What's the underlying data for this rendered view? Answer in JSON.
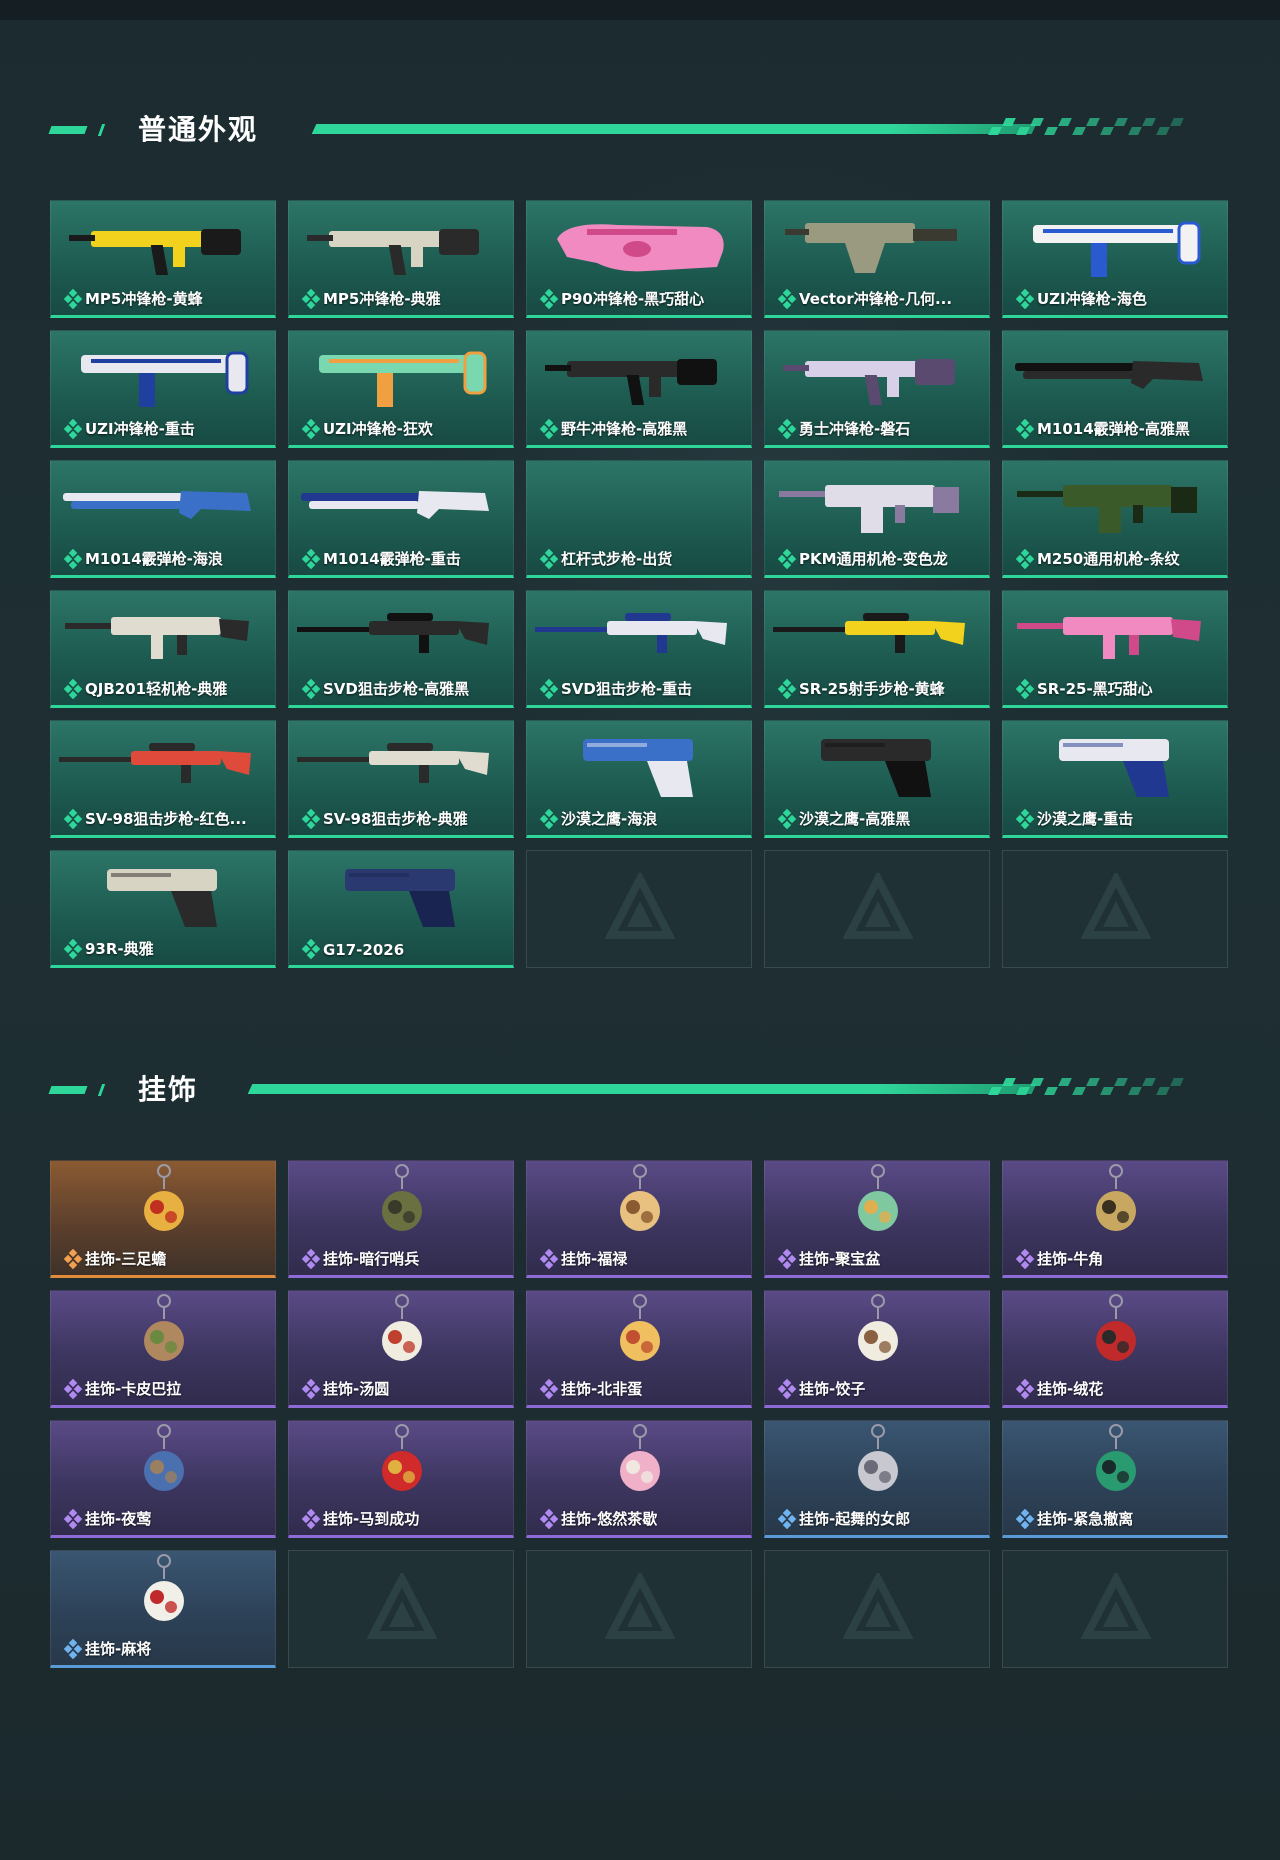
{
  "sections": {
    "skins": {
      "title": "普通外观"
    },
    "charms": {
      "title": "挂饰"
    }
  },
  "colors": {
    "accent": "#2fd69a",
    "purple": "#8d6ad6",
    "orange": "#e08a3a",
    "blue": "#5a9ad6"
  },
  "skins": [
    {
      "label": "MP5冲锋枪-黄蜂",
      "art": "smg",
      "c1": "#f2d21c",
      "c2": "#1a1a1a"
    },
    {
      "label": "MP5冲锋枪-典雅",
      "art": "smg",
      "c1": "#d8d4c4",
      "c2": "#2a2a2a"
    },
    {
      "label": "P90冲锋枪-黑巧甜心",
      "art": "p90",
      "c1": "#f08ac0",
      "c2": "#d04a8a"
    },
    {
      "label": "Vector冲锋枪-几何...",
      "art": "vector",
      "c1": "#9a9a80",
      "c2": "#3a3a30"
    },
    {
      "label": "UZI冲锋枪-海色",
      "art": "uzi",
      "c1": "#f2f2f2",
      "c2": "#2a5ad0"
    },
    {
      "label": "UZI冲锋枪-重击",
      "art": "uzi",
      "c1": "#e8e8f0",
      "c2": "#2040a0"
    },
    {
      "label": "UZI冲锋枪-狂欢",
      "art": "uzi",
      "c1": "#7ad8b0",
      "c2": "#f0a040"
    },
    {
      "label": "野牛冲锋枪-高雅黑",
      "art": "smg",
      "c1": "#2a2a2a",
      "c2": "#111111"
    },
    {
      "label": "勇士冲锋枪-磐石",
      "art": "smg",
      "c1": "#d8d0e8",
      "c2": "#5a4a70"
    },
    {
      "label": "M1014霰弹枪-高雅黑",
      "art": "shotgun",
      "c1": "#2a2a2a",
      "c2": "#111111"
    },
    {
      "label": "M1014霰弹枪-海浪",
      "art": "shotgun",
      "c1": "#3a70c8",
      "c2": "#e8e8f0"
    },
    {
      "label": "M1014霰弹枪-重击",
      "art": "shotgun",
      "c1": "#e8e8f0",
      "c2": "#203890"
    },
    {
      "label": "杠杆式步枪-出货",
      "art": "none",
      "c1": "#000000",
      "c2": "#000000"
    },
    {
      "label": "PKM通用机枪-变色龙",
      "art": "mg",
      "c1": "#e0dce8",
      "c2": "#8a7aa0"
    },
    {
      "label": "M250通用机枪-条纹",
      "art": "mg",
      "c1": "#3a5a2a",
      "c2": "#1a2a14"
    },
    {
      "label": "QJB201轻机枪-典雅",
      "art": "rifle",
      "c1": "#e0dcd0",
      "c2": "#2a2a2a"
    },
    {
      "label": "SVD狙击步枪-高雅黑",
      "art": "sniper",
      "c1": "#2a2a2a",
      "c2": "#111111"
    },
    {
      "label": "SVD狙击步枪-重击",
      "art": "sniper",
      "c1": "#e8e8f0",
      "c2": "#203890"
    },
    {
      "label": "SR-25射手步枪-黄蜂",
      "art": "sniper",
      "c1": "#f2d21c",
      "c2": "#1a1a1a"
    },
    {
      "label": "SR-25-黑巧甜心",
      "art": "rifle",
      "c1": "#f08ac0",
      "c2": "#d04a8a"
    },
    {
      "label": "SV-98狙击步枪-红色...",
      "art": "sniper",
      "c1": "#e04a3a",
      "c2": "#2a2a2a"
    },
    {
      "label": "SV-98狙击步枪-典雅",
      "art": "sniper",
      "c1": "#e0dcd0",
      "c2": "#2a2a2a"
    },
    {
      "label": "沙漠之鹰-海浪",
      "art": "pistol",
      "c1": "#3a70c8",
      "c2": "#e8e8f0"
    },
    {
      "label": "沙漠之鹰-高雅黑",
      "art": "pistol",
      "c1": "#2a2a2a",
      "c2": "#111111"
    },
    {
      "label": "沙漠之鹰-重击",
      "art": "pistol",
      "c1": "#e8e8f0",
      "c2": "#203890"
    },
    {
      "label": "93R-典雅",
      "art": "pistol",
      "c1": "#d8d4c4",
      "c2": "#2a2a2a"
    },
    {
      "label": "G17-2026",
      "art": "pistol",
      "c1": "#2a3a70",
      "c2": "#1a2450"
    }
  ],
  "charms": [
    {
      "label": "挂饰-三足蟾",
      "rarity": "orange",
      "c1": "#e8b040",
      "c2": "#c03020"
    },
    {
      "label": "挂饰-暗行哨兵",
      "rarity": "purple",
      "c1": "#6a7040",
      "c2": "#3a3a2a"
    },
    {
      "label": "挂饰-福禄",
      "rarity": "purple",
      "c1": "#e8c080",
      "c2": "#8a5a30"
    },
    {
      "label": "挂饰-聚宝盆",
      "rarity": "purple",
      "c1": "#80c8a0",
      "c2": "#e0b050"
    },
    {
      "label": "挂饰-牛角",
      "rarity": "purple",
      "c1": "#c8a860",
      "c2": "#3a3020"
    },
    {
      "label": "挂饰-卡皮巴拉",
      "rarity": "purple",
      "c1": "#b08860",
      "c2": "#6a8a40"
    },
    {
      "label": "挂饰-汤圆",
      "rarity": "purple",
      "c1": "#f0ece0",
      "c2": "#c04030"
    },
    {
      "label": "挂饰-北非蛋",
      "rarity": "purple",
      "c1": "#f0c060",
      "c2": "#c05030"
    },
    {
      "label": "挂饰-饺子",
      "rarity": "purple",
      "c1": "#f0ece0",
      "c2": "#8a6040"
    },
    {
      "label": "挂饰-绒花",
      "rarity": "purple",
      "c1": "#c02a2a",
      "c2": "#2a2a2a"
    },
    {
      "label": "挂饰-夜莺",
      "rarity": "purple",
      "c1": "#4a70b0",
      "c2": "#9a8060"
    },
    {
      "label": "挂饰-马到成功",
      "rarity": "purple",
      "c1": "#d02a2a",
      "c2": "#e0b040"
    },
    {
      "label": "挂饰-悠然茶歇",
      "rarity": "purple",
      "c1": "#f0b0c8",
      "c2": "#f0e8e0"
    },
    {
      "label": "挂饰-起舞的女郎",
      "rarity": "blue",
      "c1": "#c8c8d0",
      "c2": "#6a6a78"
    },
    {
      "label": "挂饰-紧急撤离",
      "rarity": "blue",
      "c1": "#2a9a70",
      "c2": "#1a2a2a"
    },
    {
      "label": "挂饰-麻将",
      "rarity": "blue",
      "c1": "#f0f0e8",
      "c2": "#c02a2a"
    }
  ]
}
